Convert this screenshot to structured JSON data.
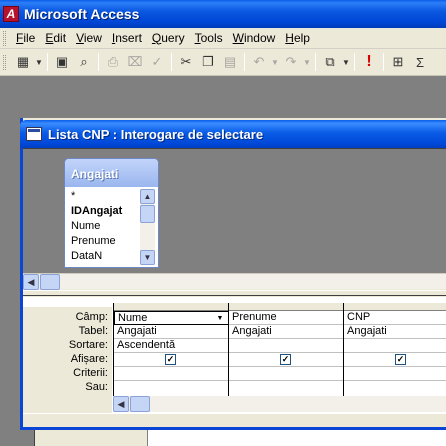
{
  "app": {
    "title": "Microsoft Access",
    "icon": "access-logo-icon"
  },
  "menu": [
    {
      "label": "File",
      "mnemonic": "F",
      "rest": "ile"
    },
    {
      "label": "Edit",
      "mnemonic": "E",
      "rest": "dit"
    },
    {
      "label": "View",
      "mnemonic": "V",
      "rest": "iew"
    },
    {
      "label": "Insert",
      "mnemonic": "I",
      "rest": "nsert"
    },
    {
      "label": "Query",
      "mnemonic": "Q",
      "rest": "uery"
    },
    {
      "label": "Tools",
      "mnemonic": "T",
      "rest": "ools"
    },
    {
      "label": "Window",
      "mnemonic": "W",
      "rest": "indow"
    },
    {
      "label": "Help",
      "mnemonic": "H",
      "rest": "elp"
    }
  ],
  "toolbar": {
    "icons": [
      "view-icon",
      "save-icon",
      "search-icon",
      "print-icon",
      "print-preview-icon",
      "spelling-icon",
      "cut-icon",
      "copy-icon",
      "paste-icon",
      "undo-icon",
      "redo-icon",
      "query-type-icon",
      "run-icon",
      "show-table-icon",
      "totals-icon"
    ],
    "run_glyph": "!",
    "totals_glyph": "Σ"
  },
  "query_window": {
    "title": "Lista CNP : Interogare de selectare",
    "table": {
      "name": "Angajati",
      "fields": [
        "*",
        "IDAngajat",
        "Nume",
        "Prenume",
        "DataN"
      ],
      "primary_key": "IDAngajat"
    }
  },
  "qbe": {
    "row_labels": {
      "field": "Câmp:",
      "table": "Tabel:",
      "sort": "Sortare:",
      "show": "Afișare:",
      "criteria": "Criterii:",
      "or": "Sau:"
    },
    "columns": [
      {
        "field": "Nume",
        "table": "Angajati",
        "sort": "Ascendentă",
        "show": true
      },
      {
        "field": "Prenume",
        "table": "Angajati",
        "sort": "",
        "show": true
      },
      {
        "field": "CNP",
        "table": "Angajati",
        "sort": "",
        "show": true
      }
    ],
    "check_glyph": "✓"
  }
}
